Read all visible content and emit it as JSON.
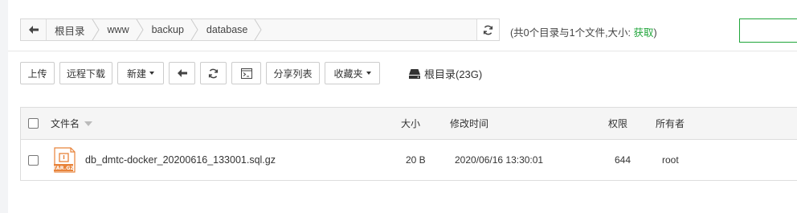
{
  "path": {
    "back_icon": "arrow-left-icon",
    "crumbs": [
      "根目录",
      "www",
      "backup",
      "database"
    ],
    "refresh_icon": "refresh-icon"
  },
  "stats": {
    "prefix": "(共0个目录与1个文件,大小: ",
    "link": "获取",
    "suffix": ")"
  },
  "search": {
    "placeholder": ""
  },
  "toolbar": {
    "upload": "上传",
    "remote_download": "远程下载",
    "new": "新建",
    "share_list": "分享列表",
    "favorites": "收藏夹",
    "disk_label": "根目录(23G)"
  },
  "table": {
    "headers": {
      "name": "文件名",
      "size": "大小",
      "mtime": "修改时间",
      "perm": "权限",
      "owner": "所有者"
    },
    "rows": [
      {
        "name": "db_dmtc-docker_20200616_133001.sql.gz",
        "size": "20 B",
        "mtime": "2020/06/16 13:30:01",
        "perm": "644",
        "owner": "root",
        "icon": "tar-gz-file-icon",
        "icon_label": "TAR.GZ"
      }
    ]
  },
  "colors": {
    "accent": "#20a53a",
    "file_icon": "#e8833a"
  }
}
